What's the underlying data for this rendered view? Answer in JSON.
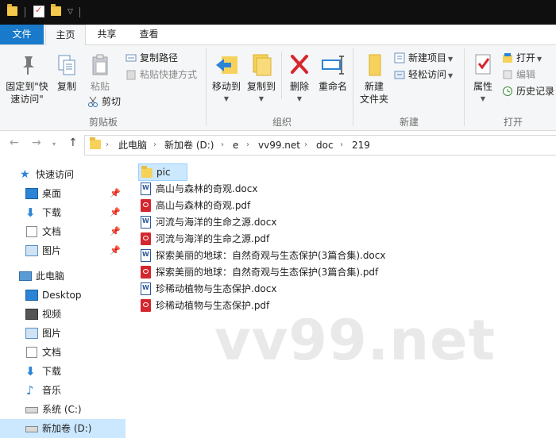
{
  "tabs": {
    "file": "文件",
    "home": "主页",
    "share": "共享",
    "view": "查看"
  },
  "ribbon": {
    "clipboard": {
      "label": "剪贴板",
      "pin_quick_access": "固定到\"快\n速访问\"",
      "copy": "复制",
      "paste": "粘贴",
      "copy_path": "复制路径",
      "paste_shortcut": "粘贴快捷方式",
      "cut": "剪切"
    },
    "organize": {
      "label": "组织",
      "move_to": "移动到",
      "copy_to": "复制到",
      "delete": "删除",
      "rename": "重命名"
    },
    "new": {
      "label": "新建",
      "new_folder": "新建\n文件夹",
      "new_item": "新建项目",
      "easy_access": "轻松访问"
    },
    "open": {
      "label": "打开",
      "properties": "属性",
      "open": "打开",
      "edit": "编辑",
      "history": "历史记录"
    }
  },
  "address": {
    "crumbs": [
      "此电脑",
      "新加卷 (D:)",
      "e",
      "vv99.net",
      "doc",
      "219"
    ]
  },
  "navpane": {
    "quick_access": "快速访问",
    "quick_items": [
      "桌面",
      "下载",
      "文档",
      "图片"
    ],
    "this_pc": "此电脑",
    "pc_items": [
      "Desktop",
      "视频",
      "图片",
      "文档",
      "下载",
      "音乐",
      "系统 (C:)",
      "新加卷 (D:)"
    ]
  },
  "files": [
    {
      "name": "pic",
      "type": "folder"
    },
    {
      "name": "高山与森林的奇观.docx",
      "type": "docx"
    },
    {
      "name": "高山与森林的奇观.pdf",
      "type": "pdf"
    },
    {
      "name": "河流与海洋的生命之源.docx",
      "type": "docx"
    },
    {
      "name": "河流与海洋的生命之源.pdf",
      "type": "pdf"
    },
    {
      "name": "探索美丽的地球：自然奇观与生态保护(3篇合集).docx",
      "type": "docx"
    },
    {
      "name": "探索美丽的地球：自然奇观与生态保护(3篇合集).pdf",
      "type": "pdf"
    },
    {
      "name": "珍稀动植物与生态保护.docx",
      "type": "docx"
    },
    {
      "name": "珍稀动植物与生态保护.pdf",
      "type": "pdf"
    }
  ],
  "watermark": "vv99.net",
  "colors": {
    "file_tab": "#1979ca",
    "selection": "#cce8ff",
    "folder": "#f7d25b",
    "pdf": "#d3262e",
    "word": "#2b579a"
  }
}
